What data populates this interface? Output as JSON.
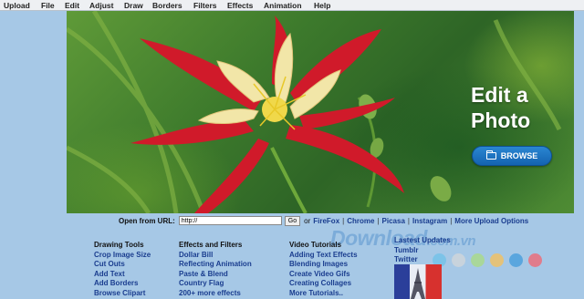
{
  "menu": [
    "Upload",
    "File",
    "Edit",
    "Adjust",
    "Draw",
    "Borders",
    "Filters",
    "Effects",
    "Animation",
    "Help"
  ],
  "hero": {
    "line1": "Edit a",
    "line2": "Photo",
    "browse_label": "BROWSE"
  },
  "url_row": {
    "label": "Open from URL:",
    "input_value": "http://",
    "go_label": "Go",
    "or_text": "or",
    "sources": [
      "FireFox",
      "Chrome",
      "Picasa",
      "Instagram",
      "More Upload Options"
    ]
  },
  "columns": {
    "tools": {
      "heading": "Drawing Tools",
      "links": [
        "Crop Image Size",
        "Cut Outs",
        "Add Text",
        "Add Borders",
        "Browse Clipart"
      ]
    },
    "effects": {
      "heading": "Effects and Filters",
      "links": [
        "Dollar Bill",
        "Reflecting Animation",
        "Paste & Blend",
        "Country Flag",
        "200+ more effects"
      ]
    },
    "tutorials": {
      "heading": "Video Tutorials",
      "links": [
        "Adding Text Effects",
        "Blending Images",
        "Create Video Gifs",
        "Creating Collages",
        "More Tutorials.."
      ]
    },
    "updates": {
      "heading": "Lastest Updates",
      "links": [
        "Tumblr",
        "Twitter"
      ]
    }
  },
  "watermark": {
    "main": "Download",
    "domain": ".com.vn"
  },
  "dot_colors": [
    "#7cc3e8",
    "#c8d3dc",
    "#a9d79a",
    "#e4c27a",
    "#5aa6de",
    "#e07c8c"
  ],
  "colors": {
    "link": "#1a3d8f",
    "background": "#a6c8e6",
    "browse_button": "#1a73c2"
  }
}
